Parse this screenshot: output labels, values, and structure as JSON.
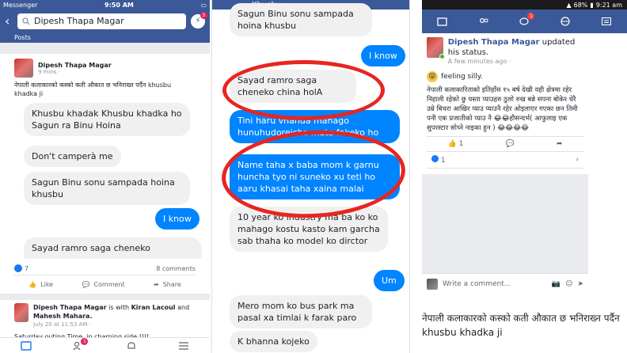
{
  "panel1": {
    "status": {
      "app": "Messenger",
      "time": "9:50 AM"
    },
    "search": {
      "value": "Dipesh Thapa Magar",
      "messenger_badge": "5"
    },
    "tab_label": "Posts",
    "post": {
      "author": "Dipesh Thapa Magar",
      "meta": "9 mins ·",
      "text": "नेपाली कलाकारको कस्को कती औकात छ भनिराख्न पर्दैन khusbu khadka ji"
    },
    "chat": [
      {
        "side": "left",
        "text": "Khusbu khadak Khusbu khadka ho\nSagun ra Binu Hoina"
      },
      {
        "side": "left",
        "text": "Don't camperà me"
      },
      {
        "side": "left",
        "text": "Sagun Binu sonu sampada hoina khusbu"
      },
      {
        "side": "right",
        "text": "I know"
      },
      {
        "side": "left",
        "text": "Sayad ramro saga cheneko"
      }
    ],
    "reactions": {
      "count": "7",
      "comments": "8 comments"
    },
    "actions": {
      "like": "Like",
      "comment": "Comment",
      "share": "Share"
    },
    "post2": {
      "author": "Dipesh Thapa Magar",
      "with_text": "is with",
      "tag1": "Kiran Lacoul",
      "and_text": "and",
      "tag2": "Mahesh Mahara.",
      "meta": "July 20 at 11:53 AM ·",
      "text": "Saturday outing Time, in charning side !!!!"
    },
    "nav_badge": "1"
  },
  "panel2": {
    "header": "Khusbu",
    "chat": [
      {
        "side": "left",
        "text": "Sagun Binu sonu sampada hoina khusbu"
      },
      {
        "side": "right",
        "text": "I know"
      },
      {
        "side": "left",
        "text": "Sayad ramro saga cheneko china holA"
      },
      {
        "side": "right",
        "text": "Tini haru vhanda mahago hunuhudoreicha mata fakeko ho"
      },
      {
        "side": "right",
        "text": "Name taha x baba mom k garnu huncha tyo ni suneko xu teti ho aaru khasai taha xaina malai"
      },
      {
        "side": "left",
        "text": "10 year ko industry ma ba ko ko mahago kostu kasto kam garcha sab thaha ko model ko dirctor"
      },
      {
        "side": "right",
        "text": "Um"
      },
      {
        "side": "left",
        "text": "Mero mom ko bus park ma pasal xa timlai k farak paro"
      },
      {
        "side": "left",
        "text": "K bhanna kojeko"
      }
    ]
  },
  "panel3": {
    "status": {
      "battery": "68%",
      "time": "9:21 am"
    },
    "nav_badge": "1",
    "post": {
      "author": "Dipesh Thapa Magar",
      "suffix": "updated his status.",
      "meta": "A few minutes ago ·",
      "feeling": "feeling silly.",
      "text": "नेपाली कलाकारिताको इतिहाँस १५ बर्ष देखी यही क्षेत्रमा रहेर निहाली रहेको छु यस्ता प्याउहरु ठुलो रुख बन्ने सपना बोकेर धेरै उम्रे बिचरा आखिर प्याउ प्याउनै रहेर ओइलाएर गएका छन तिमी पनी एक प्रजातीको प्याउ नै 😂😂हौसन्दर्भ( आफुलाइ एक सुपरस्टार सोच्ने नाइका हुन ) 😂😂😂😂"
    },
    "actions": {
      "like": "1"
    },
    "like_count": "1",
    "comment_placeholder": "Write a comment...",
    "caption": "नेपाली कलाकारको कस्को कती औकात छ भनिराख्न पर्दैन khusbu khadka ji"
  }
}
